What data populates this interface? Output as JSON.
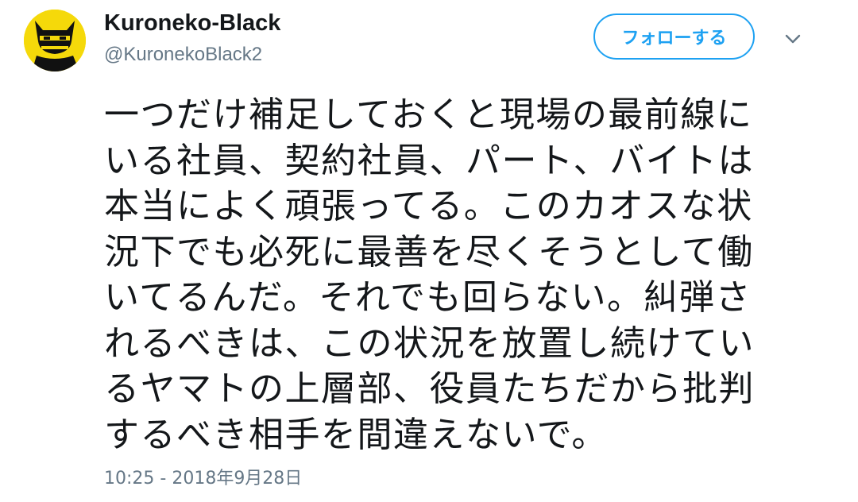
{
  "user": {
    "display_name": "Kuroneko-Black",
    "handle": "@KuronekoBlack2",
    "avatar_icon": "black-cat-icon"
  },
  "actions": {
    "follow_label": "フォローする",
    "menu_icon": "chevron-down-icon"
  },
  "tweet": {
    "lines": [
      "一つだけ補足しておくと現場の最前線に",
      "いる社員、契約社員、パート、バイトは",
      "本当によく頑張ってる。このカオスな状",
      "況下でも必死に最善を尽くそうとして働",
      "いてるんだ。それでも回らない。糾弾さ",
      "れるべきは、この状況を放置し続けてい",
      "るヤマトの上層部、役員たちだから批判",
      "するべき相手を間違えないで。"
    ],
    "timestamp": "10:25 - 2018年9月28日"
  },
  "colors": {
    "accent": "#1da1f2",
    "secondary_text": "#657786",
    "avatar_bg": "#f5d90a"
  }
}
